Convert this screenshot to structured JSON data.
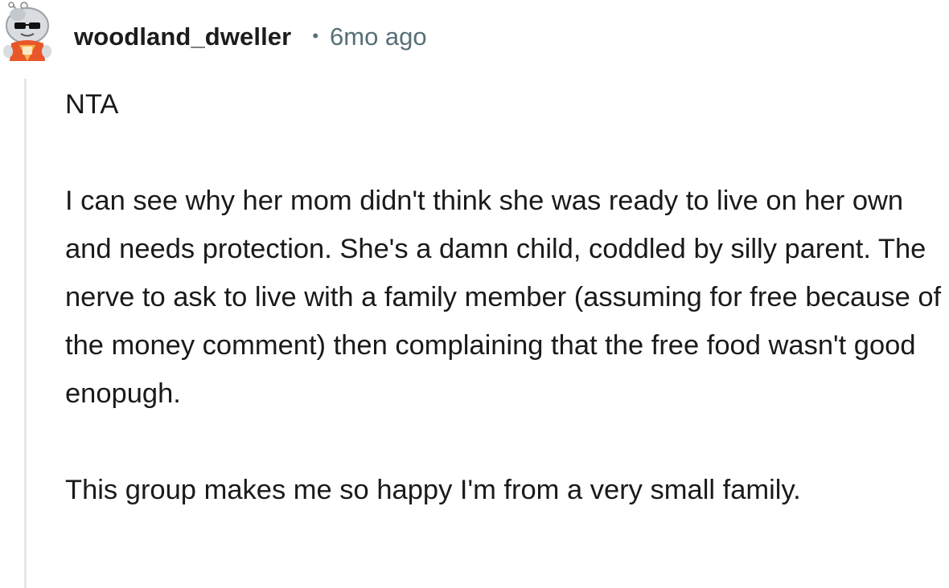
{
  "comment": {
    "author": "woodland_dweller",
    "separator": "•",
    "age": "6mo ago",
    "avatar_icon": "snoo-avatar-icon",
    "paragraphs": [
      "NTA",
      "I can see why her mom didn't think she was ready to live on her own and needs protection. She's a damn child, coddled by silly parent. The nerve to ask to live with a family member (assuming for free because of the money comment) then complaining that the free food wasn't good enopugh.",
      "This group makes me so happy I'm from a very small family."
    ]
  },
  "colors": {
    "username": "#1c1c1c",
    "meta": "#576f76",
    "body": "#1a1a1b",
    "thread_line": "#e5e7e8",
    "avatar_accent": "#e8572a"
  }
}
